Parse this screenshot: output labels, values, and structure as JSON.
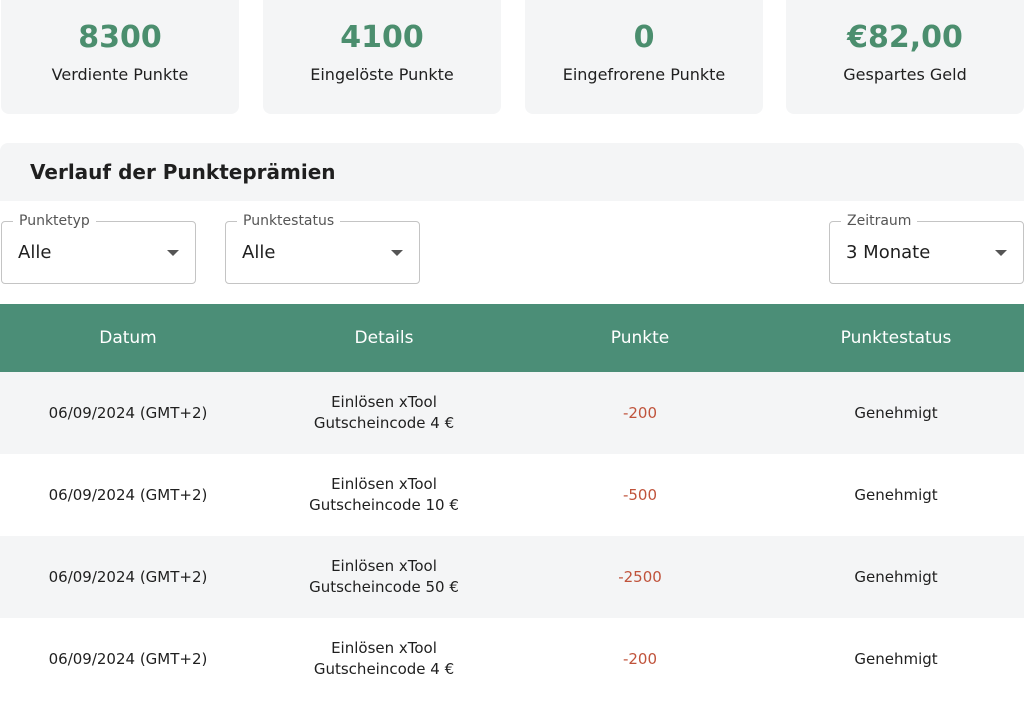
{
  "stats": [
    {
      "value": "8300",
      "label": "Verdiente Punkte"
    },
    {
      "value": "4100",
      "label": "Eingelöste Punkte"
    },
    {
      "value": "0",
      "label": "Eingefrorene Punkte"
    },
    {
      "value": "€82,00",
      "label": "Gespartes Geld"
    }
  ],
  "history": {
    "title": "Verlauf der Punkteprämien",
    "filters": {
      "type": {
        "label": "Punktetyp",
        "value": "Alle"
      },
      "status": {
        "label": "Punktestatus",
        "value": "Alle"
      },
      "period": {
        "label": "Zeitraum",
        "value": "3 Monate"
      }
    },
    "columns": [
      "Datum",
      "Details",
      "Punkte",
      "Punktestatus"
    ],
    "rows": [
      {
        "date": "06/09/2024 (GMT+2)",
        "details": "Einlösen xTool Gutscheincode 4 €",
        "points": "-200",
        "status": "Genehmigt"
      },
      {
        "date": "06/09/2024 (GMT+2)",
        "details": "Einlösen xTool Gutscheincode 10 €",
        "points": "-500",
        "status": "Genehmigt"
      },
      {
        "date": "06/09/2024 (GMT+2)",
        "details": "Einlösen xTool Gutscheincode 50 €",
        "points": "-2500",
        "status": "Genehmigt"
      },
      {
        "date": "06/09/2024 (GMT+2)",
        "details": "Einlösen xTool Gutscheincode 4 €",
        "points": "-200",
        "status": "Genehmigt"
      }
    ]
  },
  "colors": {
    "accent": "#4b8e6e",
    "header_bg": "#4b8e77",
    "negative_points": "#c0533b",
    "card_bg": "#f4f5f6"
  },
  "icons": {
    "dropdown": "caret-down-icon"
  }
}
